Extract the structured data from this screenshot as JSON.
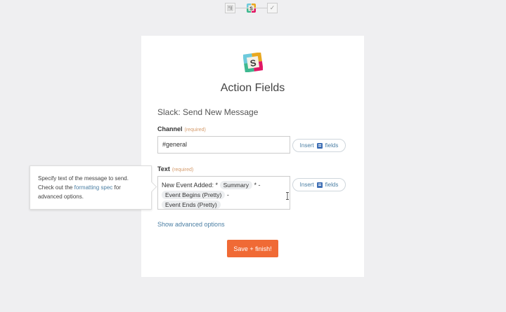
{
  "stepper": {
    "step1_icon": "schedule-icon",
    "step2_icon": "slack-icon",
    "step3_icon": "check-icon",
    "step3_glyph": "✓"
  },
  "card": {
    "title": "Action Fields",
    "subtitle": "Slack: Send New Message"
  },
  "channel": {
    "label": "Channel",
    "required": "(required)",
    "value": "#general",
    "insert_label": "Insert",
    "insert_suffix": "fields"
  },
  "text": {
    "label": "Text",
    "required": "(required)",
    "prefix": "New Event Added: *",
    "pill1": "Summary",
    "mid1": "* -",
    "pill2": "Event Begins (Pretty)",
    "mid2": "-",
    "pill3": "Event Ends (Pretty)",
    "insert_label": "Insert",
    "insert_suffix": "fields"
  },
  "tooltip": {
    "text_before": "Specify text of the message to send. Check out the ",
    "link": "formatting spec",
    "text_after": " for advanced options."
  },
  "advanced_link": "Show advanced options",
  "save_button": "Save + finish!",
  "colors": {
    "accent": "#f06a35",
    "link": "#4a7ea3",
    "required": "#d49a6a"
  }
}
